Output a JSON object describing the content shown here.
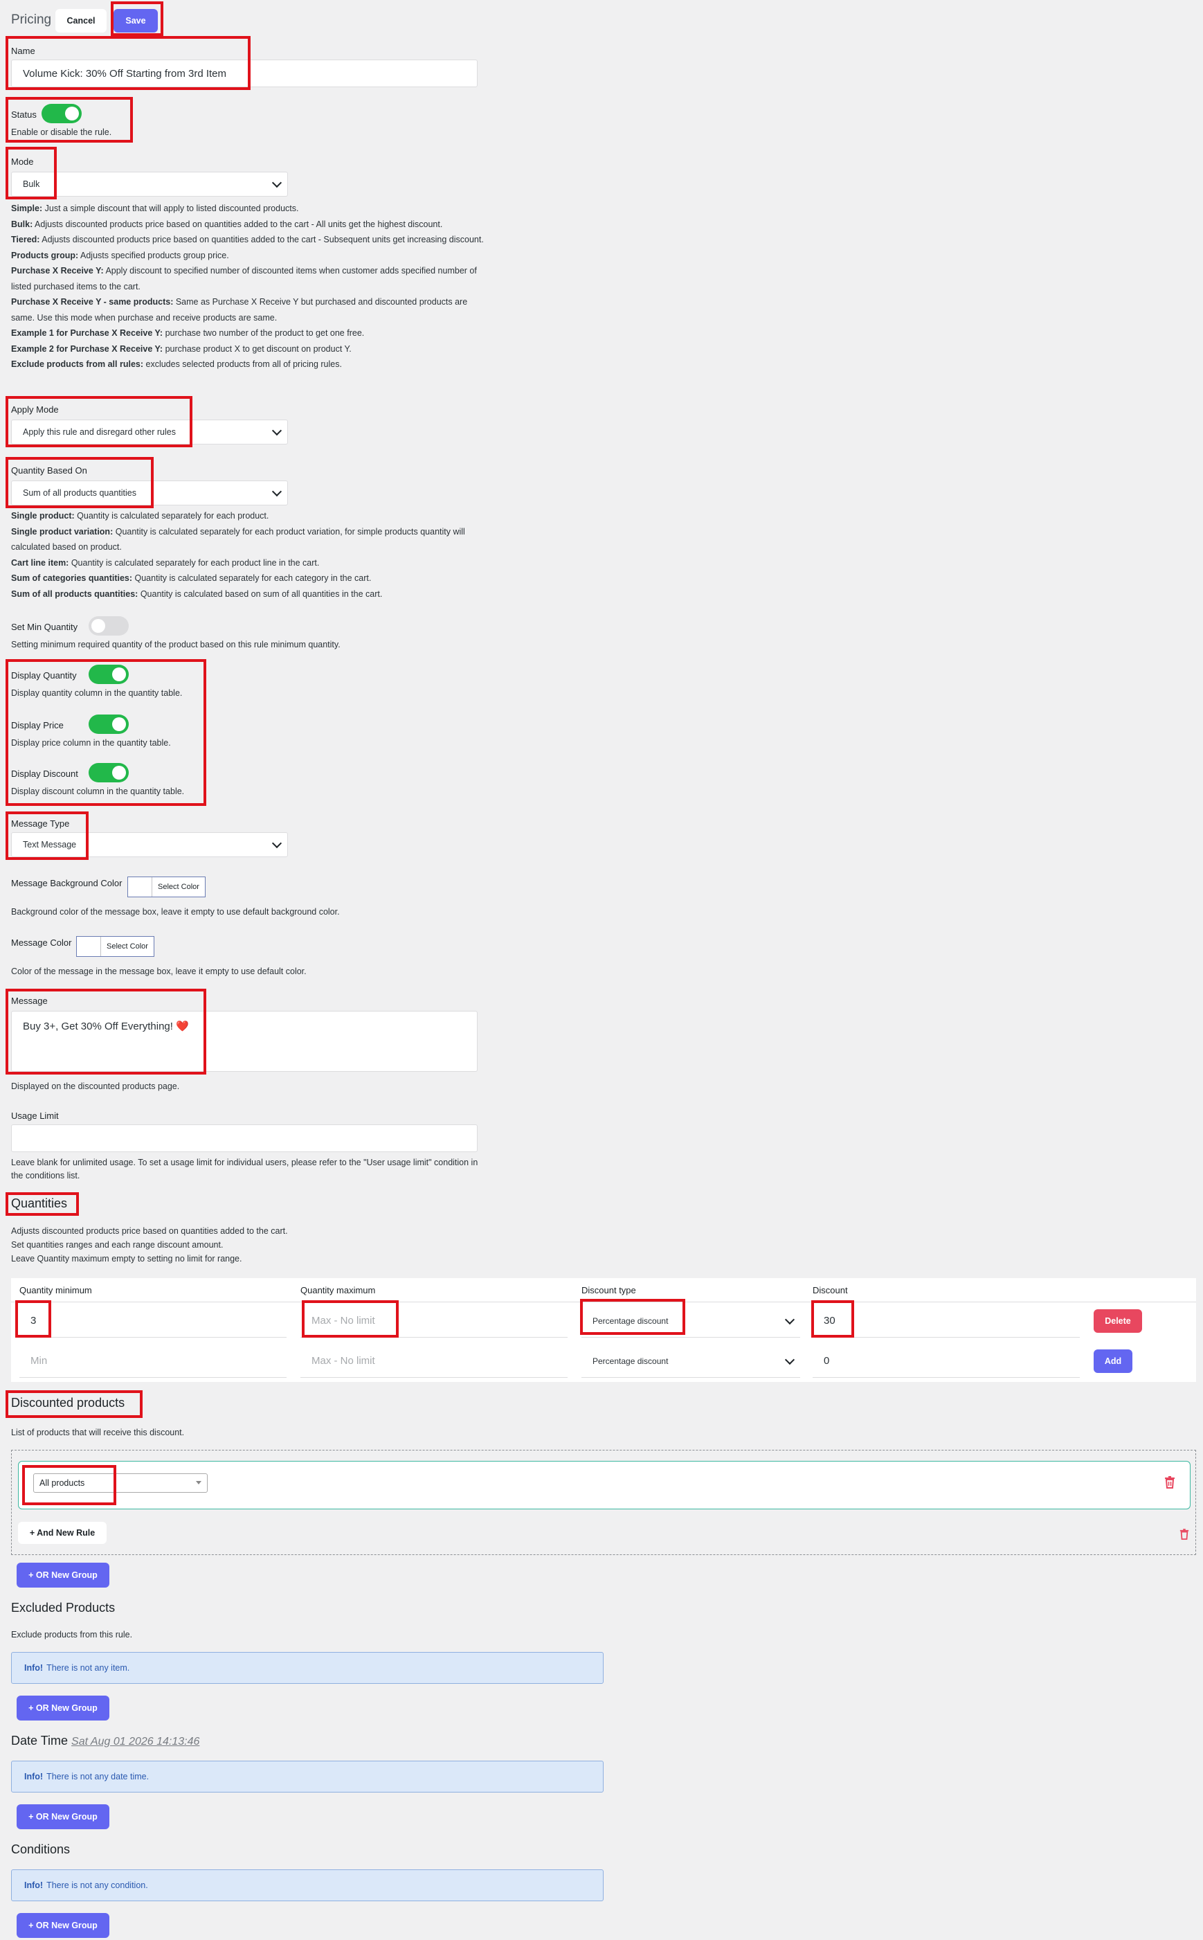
{
  "header": {
    "title": "Pricing",
    "cancel_label": "Cancel",
    "save_label": "Save"
  },
  "name": {
    "label": "Name",
    "value": "Volume Kick: 30% Off Starting from 3rd Item"
  },
  "status": {
    "label": "Status",
    "help": "Enable or disable the rule.",
    "enabled": true
  },
  "mode": {
    "label": "Mode",
    "value": "Bulk",
    "help": [
      {
        "term": "Simple:",
        "text": " Just a simple discount that will apply to listed discounted products."
      },
      {
        "term": "Bulk:",
        "text": " Adjusts discounted products price based on quantities added to the cart - All units get the highest discount."
      },
      {
        "term": "Tiered:",
        "text": " Adjusts discounted products price based on quantities added to the cart - Subsequent units get increasing discount."
      },
      {
        "term": "Products group:",
        "text": " Adjusts specified products group price."
      },
      {
        "term": "Purchase X Receive Y:",
        "text": " Apply discount to specified number of discounted items when customer adds specified number of listed purchased items to the cart."
      },
      {
        "term": "Purchase X Receive Y - same products:",
        "text": " Same as Purchase X Receive Y but purchased and discounted products are same. Use this mode when purchase and receive products are same."
      },
      {
        "term": "Example 1 for Purchase X Receive Y:",
        "text": " purchase two number of the product to get one free."
      },
      {
        "term": "Example 2 for Purchase X Receive Y:",
        "text": " purchase product X to get discount on product Y."
      },
      {
        "term": "Exclude products from all rules:",
        "text": " excludes selected products from all of pricing rules."
      }
    ]
  },
  "apply_mode": {
    "label": "Apply Mode",
    "value": "Apply this rule and disregard other rules"
  },
  "quantity_based_on": {
    "label": "Quantity Based On",
    "value": "Sum of all products quantities",
    "help": [
      {
        "term": "Single product:",
        "text": " Quantity is calculated separately for each product."
      },
      {
        "term": "Single product variation:",
        "text": " Quantity is calculated separately for each product variation, for simple products quantity will calculated based on product."
      },
      {
        "term": "Cart line item:",
        "text": " Quantity is calculated separately for each product line in the cart."
      },
      {
        "term": "Sum of categories quantities:",
        "text": " Quantity is calculated separately for each category in the cart."
      },
      {
        "term": "Sum of all products quantities:",
        "text": " Quantity is calculated based on sum of all quantities in the cart."
      }
    ]
  },
  "set_min_quantity": {
    "label": "Set Min Quantity",
    "help": "Setting minimum required quantity of the product based on this rule minimum quantity.",
    "enabled": false
  },
  "display_quantity": {
    "label": "Display Quantity",
    "help": "Display quantity column in the quantity table.",
    "enabled": true
  },
  "display_price": {
    "label": "Display Price",
    "help": "Display price column in the quantity table.",
    "enabled": true
  },
  "display_discount": {
    "label": "Display Discount",
    "help": "Display discount column in the quantity table.",
    "enabled": true
  },
  "message_type": {
    "label": "Message Type",
    "value": "Text Message"
  },
  "message_bg_color": {
    "label": "Message Background Color",
    "button": "Select Color",
    "help": "Background color of the message box, leave it empty to use default background color."
  },
  "message_color": {
    "label": "Message Color",
    "button": "Select Color",
    "help": "Color of the message in the message box, leave it empty to use default color."
  },
  "message": {
    "label": "Message",
    "value": "Buy 3+, Get 30% Off Everything! ❤️",
    "help": "Displayed on the discounted products page."
  },
  "usage_limit": {
    "label": "Usage Limit",
    "value": "",
    "help": "Leave blank for unlimited usage. To set a usage limit for individual users, please refer to the \"User usage limit\" condition in the conditions list."
  },
  "quantities": {
    "title": "Quantities",
    "help": [
      "Adjusts discounted products price based on quantities added to the cart.",
      "Set quantities ranges and each range discount amount.",
      "Leave Quantity maximum empty to setting no limit for range."
    ],
    "columns": [
      "Quantity minimum",
      "Quantity maximum",
      "Discount type",
      "Discount"
    ],
    "rows": [
      {
        "min": "3",
        "min_placeholder": "Min",
        "max": "",
        "max_placeholder": "Max - No limit",
        "type": "Percentage discount",
        "discount": "30",
        "action": "Delete"
      },
      {
        "min": "",
        "min_placeholder": "Min",
        "max": "",
        "max_placeholder": "Max - No limit",
        "type": "Percentage discount",
        "discount": "0",
        "action": "Add"
      }
    ]
  },
  "discounted_products": {
    "title": "Discounted products",
    "help": "List of products that will receive this discount.",
    "rule_value": "All products",
    "and_rule": "+ And New Rule",
    "or_group": "+ OR New Group"
  },
  "excluded_products": {
    "title": "Excluded Products",
    "help": "Exclude products from this rule.",
    "info_label": "Info!",
    "info_text": "There is not any item.",
    "or_group": "+ OR New Group"
  },
  "date_time": {
    "title": "Date Time",
    "timestamp": "Sat Aug 01 2026 14:13:46",
    "info_label": "Info!",
    "info_text": "There is not any date time.",
    "or_group": "+ OR New Group"
  },
  "conditions": {
    "title": "Conditions",
    "info_label": "Info!",
    "info_text": "There is not any condition.",
    "or_group": "+ OR New Group"
  },
  "colors": {
    "accent": "#6366f1",
    "toggle_on": "#22b84a",
    "delete": "#e8475f",
    "highlight": "#e0121b",
    "info_bg": "#dbe8f9"
  }
}
